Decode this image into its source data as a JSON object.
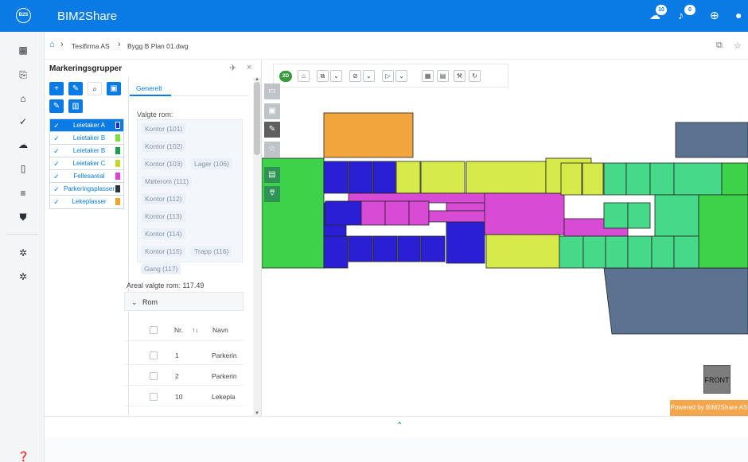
{
  "app": {
    "logo_text": "B2S",
    "title": "BIM2Share"
  },
  "topbar": {
    "icons": [
      {
        "name": "messages-icon",
        "badge": "10"
      },
      {
        "name": "bell-icon",
        "badge": "0"
      },
      {
        "name": "globe-icon"
      },
      {
        "name": "user-icon"
      }
    ]
  },
  "leftnav": {
    "items": [
      "dashboard-icon",
      "document-search-icon",
      "buildings-icon",
      "check-icon",
      "cloud-upload-icon",
      "book-icon",
      "list-icon",
      "shield-icon",
      "settings-icon",
      "settings-icon-2"
    ],
    "help_icon": "help-icon"
  },
  "breadcrumb": {
    "items": [
      "Testfirma AS",
      "Bygg B Plan 01.dwg"
    ]
  },
  "panel": {
    "title": "Markeringsgrupper",
    "groups": [
      {
        "name": "Leietaker A",
        "flag_color": "#1f2bd1",
        "selected": true
      },
      {
        "name": "Leietaker B",
        "flag_color": "#7ee03a",
        "selected": false
      },
      {
        "name": "Leietaker B",
        "flag_color": "#1f9e4a",
        "selected": false
      },
      {
        "name": "Leietaker C",
        "flag_color": "#c3d92a",
        "selected": false
      },
      {
        "name": "Fellesareal",
        "flag_color": "#e040d8",
        "selected": false
      },
      {
        "name": "Parkeringsplasser",
        "flag_color": "#2b3340",
        "selected": false
      },
      {
        "name": "Lekeplasser",
        "flag_color": "#f1a429",
        "selected": false
      }
    ],
    "tab": "Generelt",
    "selected_rooms_label": "Valgte rom:",
    "rooms": [
      "Kontor (101)",
      "Kontor (102)",
      "Kontor (103)",
      "Lager (106)",
      "Møterom (111)",
      "Kontor (112)",
      "Kontor (113)",
      "Kontor (114)",
      "Kontor (115)",
      "Trapp (116)",
      "Gang (117)"
    ],
    "area_label": "Areal valgte rom: 117.49",
    "section": "Rom",
    "table": {
      "headers": {
        "nr": "Nr.",
        "sort": "↑↓",
        "name": "Navn"
      },
      "rows": [
        {
          "nr": "1",
          "name": "Parkerin"
        },
        {
          "nr": "2",
          "name": "Parkerin"
        },
        {
          "nr": "10",
          "name": "Lekepla"
        }
      ]
    }
  },
  "viewer": {
    "mode_label": "2D",
    "front_label": "FRONT",
    "powered_label": "Powered by BIM2Share AS",
    "colors": {
      "orange": "#f2a53c",
      "green": "#3ed24a",
      "blue": "#2b1fd6",
      "lime": "#d6ea4a",
      "magenta": "#d84bd4",
      "teal": "#46d98a",
      "slate": "#5b7391"
    }
  }
}
